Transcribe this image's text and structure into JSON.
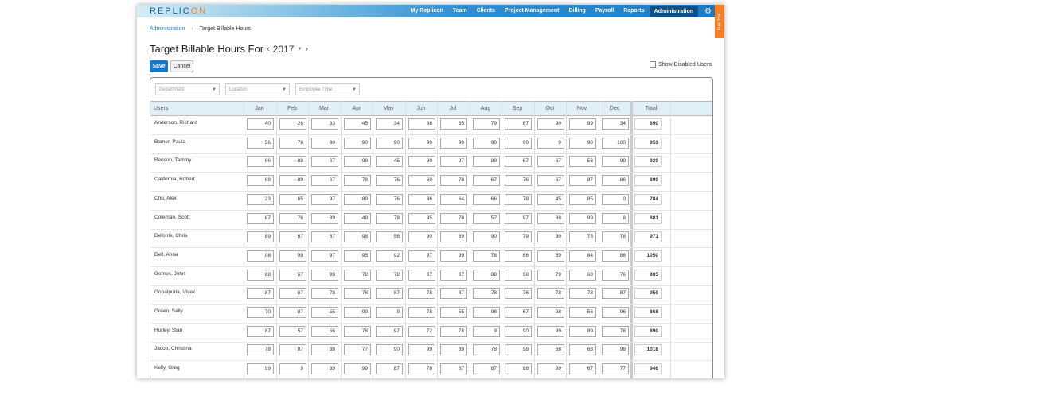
{
  "app": {
    "logo_main": "REPLIC",
    "logo_accent": "ON"
  },
  "nav": {
    "items": [
      "My Replicon",
      "Team",
      "Clients",
      "Project Management",
      "Billing",
      "Payroll",
      "Reports",
      "Administration"
    ],
    "active": "Administration",
    "settings_icon": "gear-icon"
  },
  "free_trial": "Free Trial",
  "breadcrumb": {
    "parent": "Administration",
    "separator": "›",
    "current": "Target Billable Hours"
  },
  "title": {
    "text": "Target Billable Hours For",
    "year": "2017",
    "prev_icon": "chevron-left-icon",
    "next_icon": "chevron-right-icon"
  },
  "buttons": {
    "save": "Save",
    "cancel": "Cancel"
  },
  "show_disabled": {
    "label": "Show Disabled Users",
    "checked": false
  },
  "filters": {
    "department": "Department",
    "location": "Location",
    "employee_type": "Employee Type"
  },
  "table": {
    "headers": {
      "users": "Users",
      "months": [
        "Jan",
        "Feb",
        "Mar",
        "Apr",
        "May",
        "Jun",
        "Jul",
        "Aug",
        "Sep",
        "Oct",
        "Nov",
        "Dec"
      ],
      "total": "Total"
    },
    "rows": [
      {
        "name": "Anderson, Richard",
        "values": [
          "40",
          "26",
          "33",
          "45",
          "34",
          "98",
          "65",
          "79",
          "87",
          "90",
          "99",
          "34"
        ],
        "total": "690"
      },
      {
        "name": "Bamer, Paula",
        "values": [
          "56",
          "78",
          "80",
          "90",
          "90",
          "90",
          "90",
          "90",
          "90",
          "9",
          "90",
          "100"
        ],
        "total": "953"
      },
      {
        "name": "Benson, Tammy",
        "values": [
          "66",
          "88",
          "67",
          "98",
          "45",
          "90",
          "97",
          "89",
          "67",
          "67",
          "56",
          "99"
        ],
        "total": "929"
      },
      {
        "name": "California, Robert",
        "values": [
          "68",
          "89",
          "67",
          "78",
          "76",
          "60",
          "78",
          "67",
          "76",
          "67",
          "87",
          "86"
        ],
        "total": "899"
      },
      {
        "name": "Chu, Alex",
        "values": [
          "23",
          "65",
          "97",
          "89",
          "76",
          "96",
          "64",
          "66",
          "78",
          "45",
          "85",
          "0"
        ],
        "total": "784"
      },
      {
        "name": "Coleman, Scott",
        "values": [
          "67",
          "76",
          "89",
          "49",
          "78",
          "95",
          "78",
          "57",
          "97",
          "88",
          "99",
          "8"
        ],
        "total": "881"
      },
      {
        "name": "Defonte, Chris",
        "values": [
          "89",
          "67",
          "67",
          "98",
          "56",
          "90",
          "89",
          "90",
          "79",
          "90",
          "78",
          "78"
        ],
        "total": "971"
      },
      {
        "name": "Dell, Anna",
        "values": [
          "98",
          "99",
          "97",
          "95",
          "92",
          "97",
          "99",
          "78",
          "66",
          "59",
          "84",
          "86"
        ],
        "total": "1050"
      },
      {
        "name": "Gomes, John",
        "values": [
          "88",
          "67",
          "99",
          "78",
          "78",
          "87",
          "87",
          "88",
          "98",
          "79",
          "60",
          "76"
        ],
        "total": "985"
      },
      {
        "name": "Gopalpuria, Vivek",
        "values": [
          "87",
          "67",
          "78",
          "78",
          "87",
          "78",
          "87",
          "78",
          "76",
          "78",
          "78",
          "87"
        ],
        "total": "959"
      },
      {
        "name": "Green, Sally",
        "values": [
          "70",
          "87",
          "55",
          "99",
          "9",
          "78",
          "55",
          "98",
          "67",
          "98",
          "56",
          "96"
        ],
        "total": "868"
      },
      {
        "name": "Hurley, Stan",
        "values": [
          "87",
          "57",
          "56",
          "78",
          "97",
          "72",
          "78",
          "9",
          "90",
          "99",
          "89",
          "78"
        ],
        "total": "890"
      },
      {
        "name": "Jacob, Christina",
        "values": [
          "78",
          "87",
          "88",
          "77",
          "90",
          "99",
          "89",
          "78",
          "98",
          "68",
          "68",
          "98"
        ],
        "total": "1018"
      },
      {
        "name": "Kelly, Greg",
        "values": [
          "99",
          "9",
          "89",
          "99",
          "87",
          "78",
          "67",
          "87",
          "88",
          "99",
          "67",
          "77"
        ],
        "total": "946"
      }
    ]
  }
}
